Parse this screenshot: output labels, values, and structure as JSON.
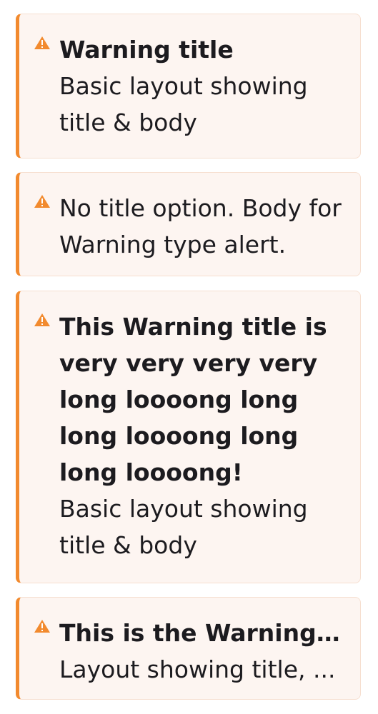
{
  "colors": {
    "accent": "#f28a2e",
    "alert_background": "#fdf5f1",
    "alert_border": "#f6dfd0",
    "text": "#1c1b1f"
  },
  "alerts": [
    {
      "icon": "warning-icon",
      "title": "Warning title",
      "body": "Basic layout showing title & body"
    },
    {
      "icon": "warning-icon",
      "body": "No title option. Body for Warning type alert."
    },
    {
      "icon": "warning-icon",
      "title": "This Warning title is very very very very long loooong long long loooong long long loooong!",
      "body": "Basic layout showing title & body"
    },
    {
      "icon": "warning-icon",
      "title": "This is the Warning ti...",
      "body": "Layout showing title, ..."
    }
  ]
}
